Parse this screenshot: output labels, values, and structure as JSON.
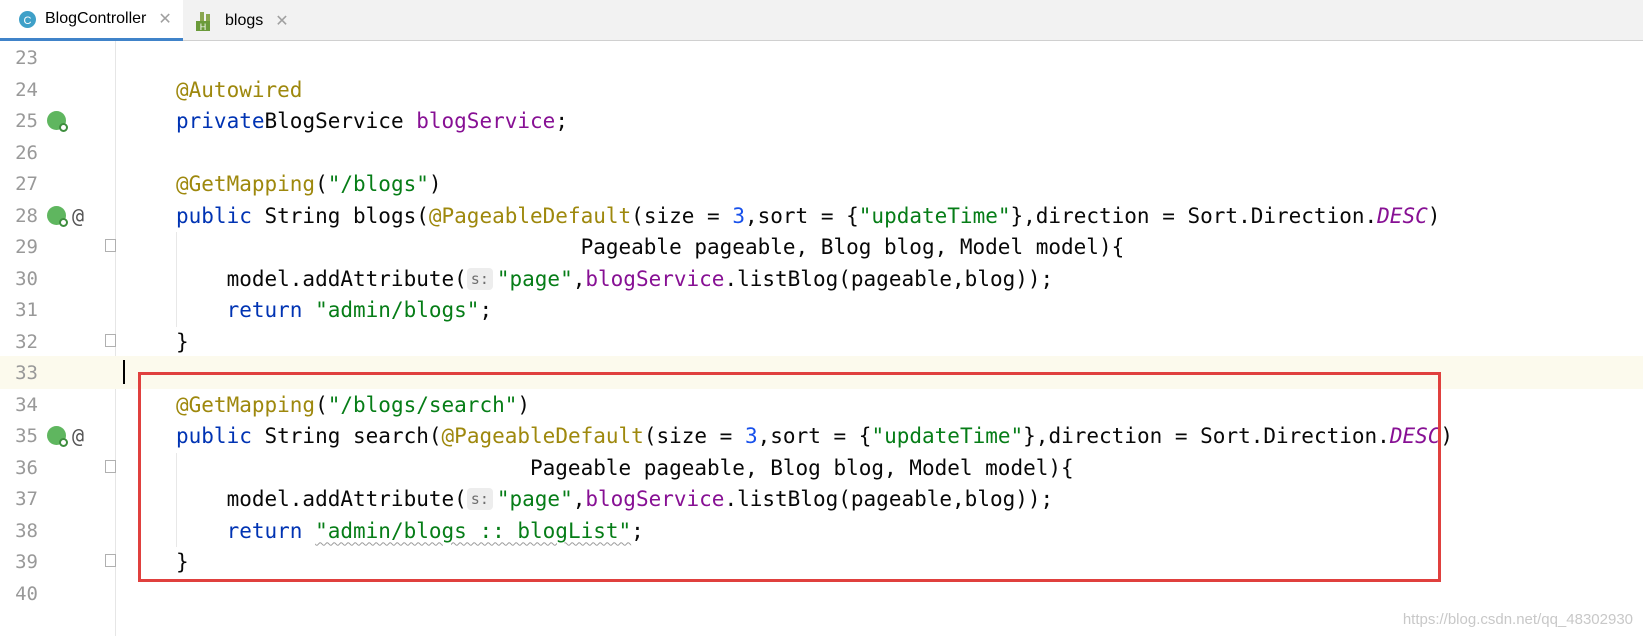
{
  "tabs": [
    {
      "label": "BlogController",
      "icon": "class-icon",
      "active": true
    },
    {
      "label": "blogs",
      "icon": "html-file-icon",
      "active": false
    }
  ],
  "editor": {
    "lines": [
      {
        "n": "23",
        "tokens": []
      },
      {
        "n": "24",
        "tokens": [
          [
            "ann",
            "@Autowired"
          ]
        ]
      },
      {
        "n": "25",
        "tokens": [
          [
            "kw",
            "private"
          ],
          [
            "",
            "BlogService "
          ],
          [
            "fld",
            "blogService"
          ],
          [
            "",
            ";"
          ]
        ]
      },
      {
        "n": "26",
        "tokens": []
      },
      {
        "n": "27",
        "tokens": [
          [
            "ann",
            "@GetMapping"
          ],
          [
            "",
            "("
          ],
          [
            "str",
            "\"/blogs\""
          ],
          [
            "",
            ")"
          ]
        ]
      },
      {
        "n": "28",
        "tokens": [
          [
            "kw",
            "public"
          ],
          [
            "",
            " String "
          ],
          [
            "",
            "blogs("
          ],
          [
            "ann",
            "@PageableDefault"
          ],
          [
            "",
            "(size = "
          ],
          [
            "num",
            "3"
          ],
          [
            "",
            ",sort = {"
          ],
          [
            "str",
            "\"updateTime\""
          ],
          [
            "",
            "},direction = Sort.Direction."
          ],
          [
            "const",
            "DESC"
          ],
          [
            "",
            ")"
          ]
        ]
      },
      {
        "n": "29",
        "tokens": [
          [
            "",
            "                                Pageable pageable, Blog blog, Model model){"
          ]
        ]
      },
      {
        "n": "30",
        "tokens": [
          [
            "",
            "    model.addAttribute("
          ],
          [
            "hint",
            "s:"
          ],
          [
            "str",
            "\"page\""
          ],
          [
            "",
            ","
          ],
          [
            "fld",
            "blogService"
          ],
          [
            "",
            ".listBlog(pageable,blog));"
          ]
        ]
      },
      {
        "n": "31",
        "tokens": [
          [
            "",
            "    "
          ],
          [
            "kw",
            "return"
          ],
          [
            "",
            " "
          ],
          [
            "str",
            "\"admin/blogs\""
          ],
          [
            "",
            ";"
          ]
        ]
      },
      {
        "n": "32",
        "tokens": [
          [
            "",
            "}"
          ]
        ]
      },
      {
        "n": "33",
        "tokens": []
      },
      {
        "n": "34",
        "tokens": [
          [
            "ann",
            "@GetMapping"
          ],
          [
            "",
            "("
          ],
          [
            "str",
            "\"/blogs/search\""
          ],
          [
            "",
            ")"
          ]
        ]
      },
      {
        "n": "35",
        "tokens": [
          [
            "kw",
            "public"
          ],
          [
            "",
            " String "
          ],
          [
            "",
            "search("
          ],
          [
            "ann",
            "@PageableDefault"
          ],
          [
            "",
            "(size = "
          ],
          [
            "num",
            "3"
          ],
          [
            "",
            ",sort = {"
          ],
          [
            "str",
            "\"updateTime\""
          ],
          [
            "",
            "},direction = Sort.Direction."
          ],
          [
            "const",
            "DESC"
          ],
          [
            "",
            ")"
          ]
        ]
      },
      {
        "n": "36",
        "tokens": [
          [
            "",
            "                            Pageable pageable, Blog blog, Model model){"
          ]
        ]
      },
      {
        "n": "37",
        "tokens": [
          [
            "",
            "    model.addAttribute("
          ],
          [
            "hint",
            "s:"
          ],
          [
            "str",
            "\"page\""
          ],
          [
            "",
            ","
          ],
          [
            "fld",
            "blogService"
          ],
          [
            "",
            ".listBlog(pageable,blog));"
          ]
        ]
      },
      {
        "n": "38",
        "tokens": [
          [
            "",
            "    "
          ],
          [
            "kw",
            "return"
          ],
          [
            "",
            " "
          ],
          [
            "str-sq",
            "\"admin/blogs :: blogList\""
          ],
          [
            "",
            ";"
          ]
        ]
      },
      {
        "n": "39",
        "tokens": [
          [
            "",
            "}"
          ]
        ]
      },
      {
        "n": "40",
        "tokens": []
      }
    ],
    "gutter": {
      "25": [
        "bean-icon"
      ],
      "28": [
        "bean-icon",
        "@"
      ],
      "35": [
        "bean-icon",
        "@"
      ]
    }
  },
  "watermark": "https://blog.csdn.net/qq_48302930"
}
